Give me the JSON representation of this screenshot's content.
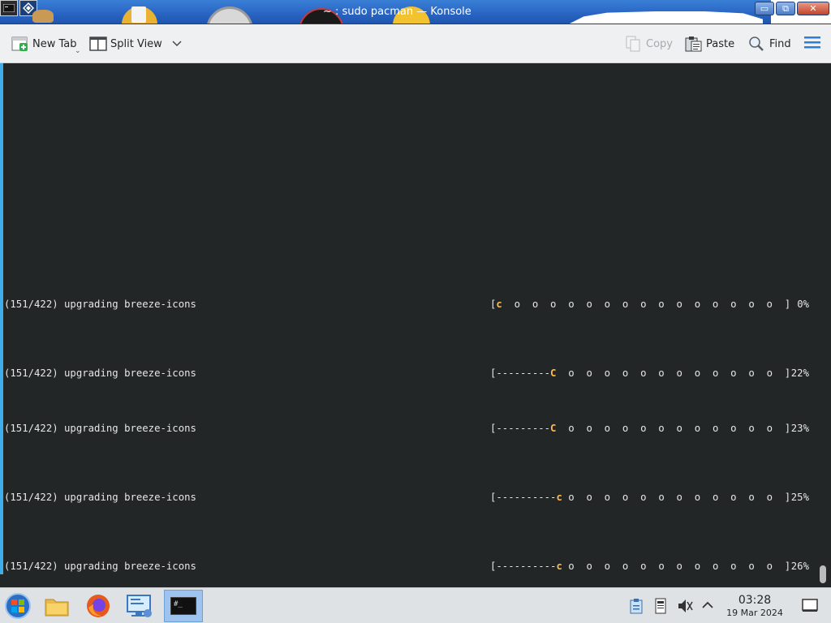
{
  "window": {
    "title": "~ : sudo pacman — Konsole",
    "buttons": {
      "minimize": "▭",
      "maximize": "⧉",
      "close": "✕"
    }
  },
  "toolbar": {
    "new_tab": "New Tab",
    "split_view": "Split View",
    "copy": "Copy",
    "paste": "Paste",
    "find": "Find"
  },
  "terminal": {
    "lines": [
      {
        "text": "(151/422) upgrading breeze-icons",
        "bar_open": "[",
        "bar_dashes": "",
        "pacman": "c",
        "dots": "  o  o  o  o  o  o  o  o  o  o  o  o  o  o  o  ",
        "bar_close": "]",
        "percent": "0%"
      },
      {
        "text": "(151/422) upgrading breeze-icons",
        "bar_open": "[",
        "bar_dashes": "---------",
        "pacman": "C",
        "dots": "  o  o  o  o  o  o  o  o  o  o  o  o  ",
        "bar_close": "]",
        "percent": "22%"
      },
      {
        "text": "(151/422) upgrading breeze-icons",
        "bar_open": "[",
        "bar_dashes": "---------",
        "pacman": "C",
        "dots": "  o  o  o  o  o  o  o  o  o  o  o  o  ",
        "bar_close": "]",
        "percent": "23%"
      },
      {
        "text": "(151/422) upgrading breeze-icons",
        "bar_open": "[",
        "bar_dashes": "----------",
        "pacman": "c",
        "dots": " o  o  o  o  o  o  o  o  o  o  o  o  ",
        "bar_close": "]",
        "percent": "25%"
      },
      {
        "text": "(151/422) upgrading breeze-icons",
        "bar_open": "[",
        "bar_dashes": "----------",
        "pacman": "c",
        "dots": " o  o  o  o  o  o  o  o  o  o  o  o  ",
        "bar_close": "]",
        "percent": "26%"
      }
    ]
  },
  "taskbar": {
    "terminal_icon_text": "#_",
    "clock_time": "03:28",
    "clock_date": "19 Mar 2024"
  },
  "colors": {
    "terminal_bg": "#232627",
    "terminal_fg": "#e6e6e6",
    "pacman": "#fdbc4b",
    "accent": "#3daee9",
    "titlebar": "#2a66c4"
  },
  "icons": [
    "new-tab-icon",
    "split-view-icon",
    "copy-icon",
    "paste-icon",
    "find-icon",
    "hamburger-menu-icon",
    "start-menu-icon",
    "file-manager-icon",
    "firefox-icon",
    "remote-desktop-icon",
    "konsole-icon",
    "clipboard-icon",
    "storage-icon",
    "volume-muted-icon",
    "expand-tray-icon",
    "show-desktop-icon"
  ]
}
